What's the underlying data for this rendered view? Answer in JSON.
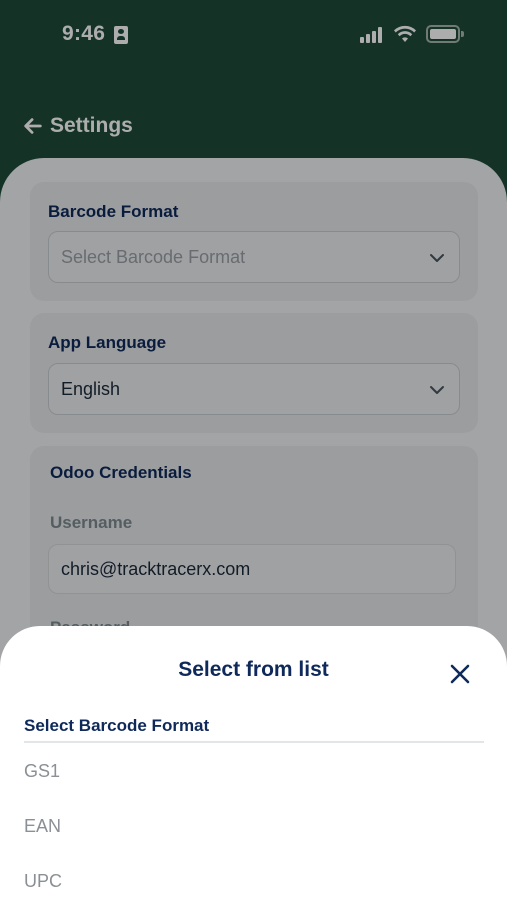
{
  "status_bar": {
    "time": "9:46",
    "icons": [
      "id-card-icon",
      "signal-icon",
      "wifi-icon",
      "battery-icon"
    ]
  },
  "nav": {
    "back_label": "Settings",
    "icon": "arrow-left-icon"
  },
  "settings": {
    "barcode_format": {
      "title": "Barcode Format",
      "placeholder": "Select Barcode Format",
      "icon": "chevron-down-icon"
    },
    "app_language": {
      "title": "App Language",
      "value": "English",
      "icon": "chevron-down-icon"
    },
    "odoo_credentials": {
      "title": "Odoo Credentials",
      "username_label": "Username",
      "username_value": "chris@tracktracerx.com",
      "password_label": "Password"
    }
  },
  "sheet": {
    "title": "Select from list",
    "close_icon": "close-icon",
    "list_heading": "Select Barcode Format",
    "options": [
      "GS1",
      "EAN",
      "UPC"
    ]
  },
  "colors": {
    "header_green": "#1f4a38",
    "navy": "#0f2a5a",
    "muted_gray": "#8a9095"
  }
}
